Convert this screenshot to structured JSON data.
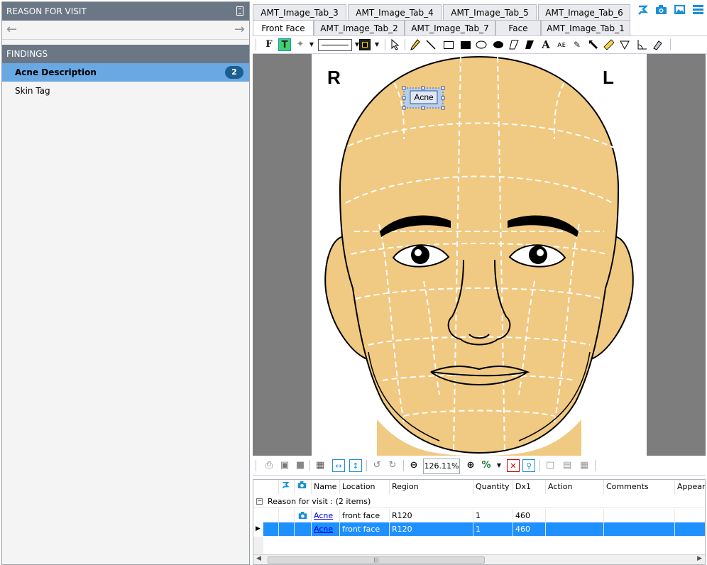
{
  "left_panel": {
    "reason_header": "REASON FOR VISIT",
    "findings_header": "FINDINGS",
    "findings": [
      {
        "label": "Acne Description",
        "count": "2"
      },
      {
        "label": "Skin Tag",
        "count": ""
      }
    ]
  },
  "tabs": {
    "row1": [
      "AMT_Image_Tab_3",
      "AMT_Image_Tab_4",
      "AMT_Image_Tab_5",
      "AMT_Image_Tab_6"
    ],
    "row2": [
      "Front Face",
      "AMT_Image_Tab_2",
      "AMT_Image_Tab_7",
      "Face",
      "AMT_Image_Tab_1"
    ],
    "active": "Front Face"
  },
  "image": {
    "label_right": "R",
    "label_left": "L",
    "annotation": "Acne",
    "colors": {
      "skin": "#f0c982",
      "canvas_bg": "#7d7d7d"
    }
  },
  "viewbar": {
    "zoom": "126.11%",
    "percent_symbol": "%"
  },
  "grid": {
    "columns": [
      "Name",
      "Location",
      "Region",
      "Quantity",
      "Dx1",
      "Action",
      "Comments",
      "Appeara"
    ],
    "group_label": "Reason for visit :  (2 items)",
    "rows": [
      {
        "name": "Acne",
        "location": "front face",
        "region": "R120",
        "quantity": "1",
        "dx1": "460"
      },
      {
        "name": "Acne",
        "location": "front face",
        "region": "R120",
        "quantity": "1",
        "dx1": "460"
      }
    ],
    "selected_row": 1
  },
  "icons": [
    "document-icon",
    "back-arrow-icon",
    "forward-arrow-icon",
    "pin-icon",
    "camera-icon",
    "image-icon",
    "list-icon",
    "print-icon",
    "zoom-in-icon",
    "zoom-out-icon"
  ]
}
